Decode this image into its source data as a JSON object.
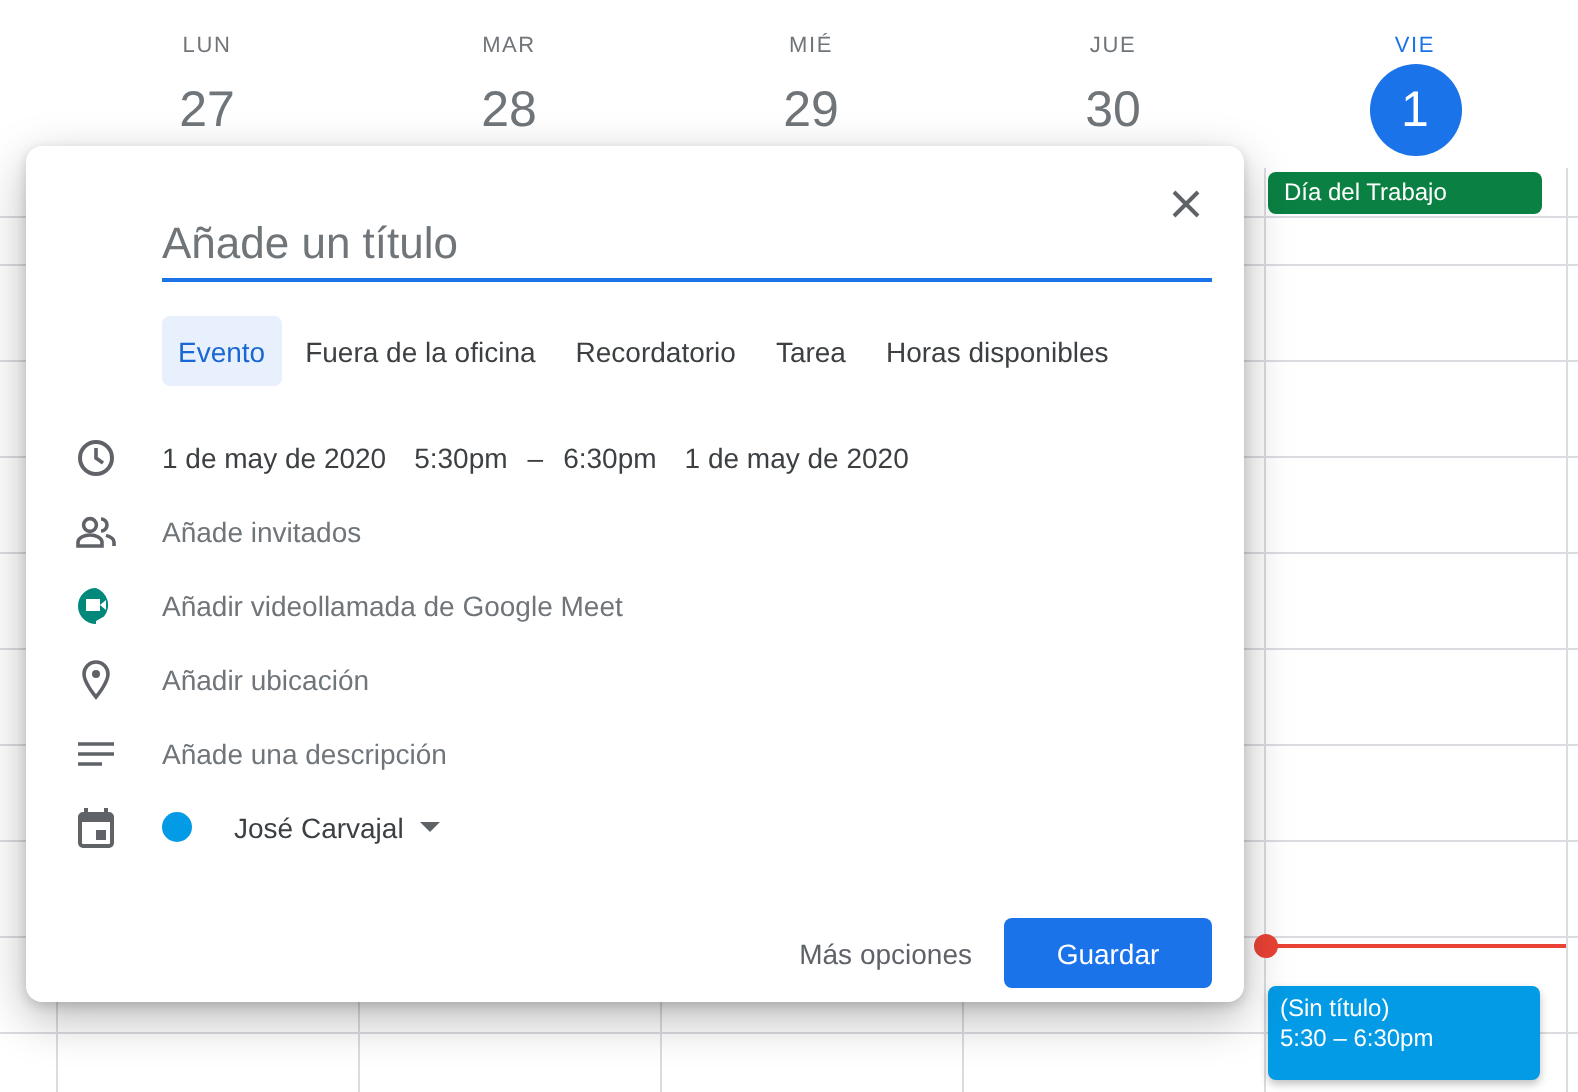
{
  "days": [
    {
      "weekday": "LUN",
      "date": "27",
      "selected": false
    },
    {
      "weekday": "MAR",
      "date": "28",
      "selected": false
    },
    {
      "weekday": "MIÉ",
      "date": "29",
      "selected": false
    },
    {
      "weekday": "JUE",
      "date": "30",
      "selected": false
    },
    {
      "weekday": "VIE",
      "date": "1",
      "selected": true,
      "all_day_event": "Día del Trabajo",
      "events": [
        {
          "title": "(Sin título)",
          "time": "5:30 – 6:30pm"
        }
      ]
    }
  ],
  "dialog": {
    "title_placeholder": "Añade un título",
    "tabs": [
      {
        "label": "Evento",
        "selected": true
      },
      {
        "label": "Fuera de la oficina",
        "selected": false
      },
      {
        "label": "Recordatorio",
        "selected": false
      },
      {
        "label": "Tarea",
        "selected": false
      },
      {
        "label": "Horas disponibles",
        "selected": false
      }
    ],
    "rows": [
      {
        "kind": "datetime",
        "start_date": "1 de may de 2020",
        "start_time": "5:30pm",
        "separator": "–",
        "end_time": "6:30pm",
        "end_date": "1 de may de 2020"
      },
      {
        "kind": "guests",
        "text": "Añade invitados"
      },
      {
        "kind": "meet",
        "text": "Añadir videollamada de Google Meet"
      },
      {
        "kind": "location",
        "text": "Añadir ubicación"
      },
      {
        "kind": "description",
        "text": "Añade una descripción"
      },
      {
        "kind": "calendar",
        "owner": "José Carvajal",
        "color": "#039be5"
      }
    ],
    "more_options": "Más opciones",
    "save": "Guardar"
  }
}
